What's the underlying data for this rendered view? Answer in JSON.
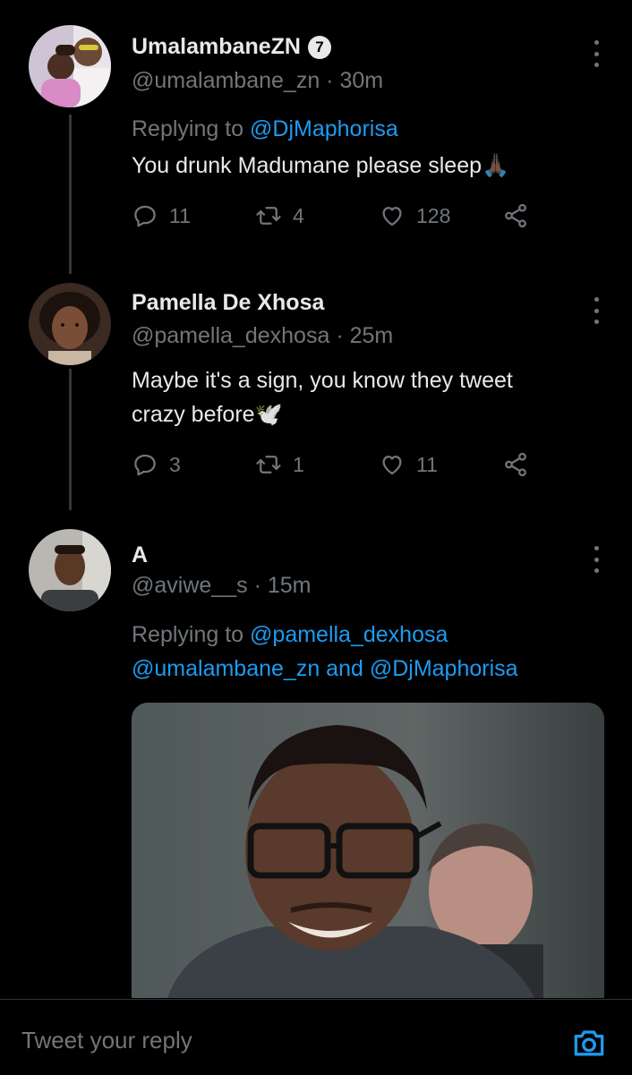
{
  "tweets": [
    {
      "display_name": "UmalambaneZN",
      "handle": "@umalambane_zn",
      "time": "· 30m",
      "replying_prefix": "Replying to",
      "replying_to": "@DjMaphorisa",
      "text": "You drunk Madumane please sleep",
      "emoji": "🙏🏿",
      "replies": "11",
      "retweets": "4",
      "likes": "128"
    },
    {
      "display_name": "Pamella De Xhosa",
      "handle": "@pamella_dexhosa",
      "time": "· 25m",
      "text_line1": "Maybe it's a sign, you know they tweet",
      "text_line2": "crazy before",
      "emoji": "🕊️",
      "replies": "3",
      "retweets": "1",
      "likes": "11"
    },
    {
      "display_name": "A",
      "handle": "@aviwe__s",
      "time": "· 15m",
      "replying_prefix": "Replying to",
      "replying_to_line1": "@pamella_dexhosa",
      "replying_to_line2_a": "@umalambane_zn",
      "replying_to_and": "and",
      "replying_to_line2_b": "@DjMaphorisa"
    }
  ],
  "reply_bar": {
    "placeholder": "Tweet your reply"
  },
  "icons": {
    "reply": "reply-icon",
    "retweet": "retweet-icon",
    "like": "heart-icon",
    "share": "share-icon",
    "camera": "camera-icon",
    "verified": "verified-badge-icon"
  },
  "colors": {
    "background": "#000000",
    "text": "#e7e9ea",
    "secondary": "#71767b",
    "link": "#1d9bf0"
  }
}
